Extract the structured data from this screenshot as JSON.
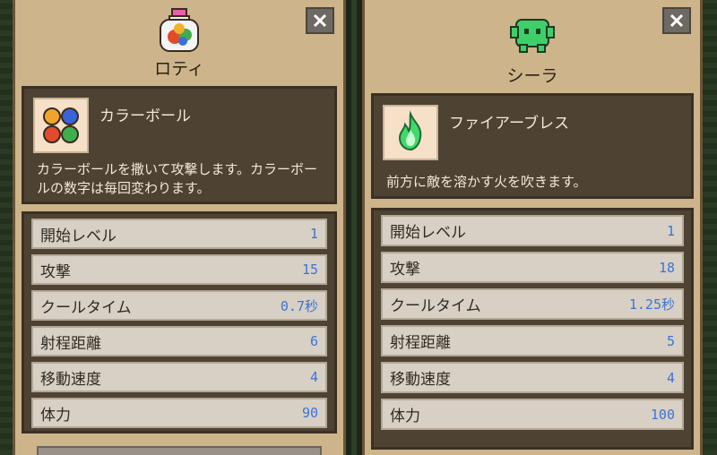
{
  "cards": [
    {
      "character_name": "ロティ",
      "character_icon": "jar-icon",
      "skill": {
        "name": "カラーボール",
        "icon": "color-balls-icon",
        "description": "カラーボールを撒いて攻撃します。カラーボールの数字は毎回変わります。"
      },
      "stats": [
        {
          "label": "開始レベル",
          "value": "1"
        },
        {
          "label": "攻撃",
          "value": "15"
        },
        {
          "label": "クールタイム",
          "value": "0.7秒"
        },
        {
          "label": "射程距離",
          "value": "6"
        },
        {
          "label": "移動速度",
          "value": "4"
        },
        {
          "label": "体力",
          "value": "90"
        }
      ]
    },
    {
      "character_name": "シーラ",
      "character_icon": "green-monster-icon",
      "skill": {
        "name": "ファイアーブレス",
        "icon": "green-fire-icon",
        "description": "前方に敵を溶かす火を吹きます。"
      },
      "stats": [
        {
          "label": "開始レベル",
          "value": "1"
        },
        {
          "label": "攻撃",
          "value": "18"
        },
        {
          "label": "クールタイム",
          "value": "1.25秒"
        },
        {
          "label": "射程距離",
          "value": "5"
        },
        {
          "label": "移動速度",
          "value": "4"
        },
        {
          "label": "体力",
          "value": "100"
        }
      ]
    }
  ],
  "colors": {
    "panel_bg": "#ceb48a",
    "dark_box": "#4e4233",
    "stat_row": "#d8d0c4",
    "stat_value": "#3a74d8",
    "light_text": "#f1e9d6"
  }
}
